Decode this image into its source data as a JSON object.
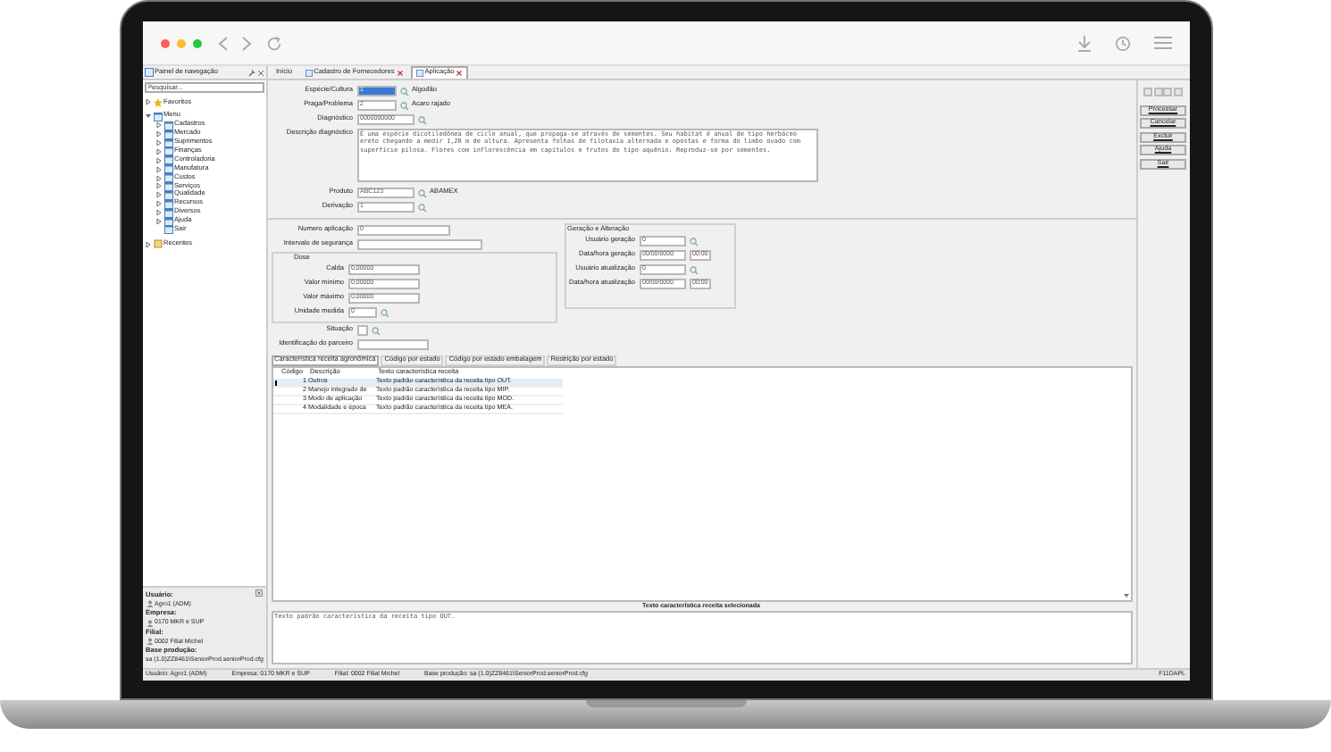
{
  "navigation_panel": {
    "title": "Painel de navegação",
    "search": {
      "placeholder": "Pesquisar..."
    },
    "tree": [
      {
        "label": "Favoritos",
        "kind": "star",
        "expanded": false
      },
      {
        "label": "Menu",
        "kind": "folder",
        "expanded": true,
        "children": [
          {
            "label": "Cadastros",
            "expanded": false
          },
          {
            "label": "Mercado",
            "expanded": false
          },
          {
            "label": "Suprimentos",
            "expanded": false
          },
          {
            "label": "Finanças",
            "expanded": false
          },
          {
            "label": "Controladoria",
            "expanded": false
          },
          {
            "label": "Manufatura",
            "expanded": false
          },
          {
            "label": "Custos",
            "expanded": false
          },
          {
            "label": "Serviços",
            "expanded": false
          },
          {
            "label": "Qualidade",
            "expanded": false
          },
          {
            "label": "Recursos",
            "expanded": false
          },
          {
            "label": "Diversos",
            "expanded": false
          },
          {
            "label": "Ajuda",
            "expanded": false
          },
          {
            "label": "Sair"
          }
        ]
      },
      {
        "label": "Recentes",
        "kind": "clock",
        "expanded": false
      }
    ],
    "session": [
      {
        "label": "Usuário:",
        "value": "Agro1 (ADM)"
      },
      {
        "label": "Empresa:",
        "value": "0170 MKR e SUP"
      },
      {
        "label": "Filial:",
        "value": "0002 Filial Michel"
      },
      {
        "label": "Base produção:",
        "value": "sa (1.0)ZZ8461\\SeniorProd.seniorProd.cfg"
      }
    ]
  },
  "tabs": [
    {
      "label": "Início",
      "closable": false,
      "selected": false
    },
    {
      "label": "Cadastro de Fornecedores",
      "closable": true,
      "selected": false
    },
    {
      "label": "Aplicação",
      "closable": true,
      "selected": true
    }
  ],
  "form": {
    "top": [
      {
        "label": "Espécie/Cultura",
        "value": "1",
        "focused": true,
        "lookup": "Algodão"
      },
      {
        "label": "Praga/Problema",
        "value": "2",
        "focused": false,
        "lookup": "Acaro rajado"
      },
      {
        "label": "Diagnóstico",
        "value": "0000000000",
        "focused": false
      }
    ],
    "description": {
      "label": "Descrição diagnóstico",
      "value": "É uma espécie dicotiledônea de ciclo anual, que propaga-se através de sementes. Seu habitat é anual de tipo herbáceo ereto chegando a medir 1,20 m de altura. Apresenta folhas de filotaxia alternada e opostas e forma do limbo ovado com superfície pilosa. Flores com inflorescência em capítulos e frutos do tipo aquênio. Reproduz-se por sementes."
    },
    "product": [
      {
        "label": "Produto",
        "value": "ABC123",
        "lookup": "ABAMEX"
      },
      {
        "label": "Derivação",
        "value": "1"
      }
    ],
    "application": [
      {
        "label": "Numero aplicação",
        "value": "0"
      },
      {
        "label": "Intervalo de segurança"
      }
    ],
    "dose": {
      "label": "Dose",
      "fields": [
        {
          "label": "Calda",
          "value": "0,00000"
        },
        {
          "label": "Valor mínimo",
          "value": "0,00000"
        },
        {
          "label": "Valor máximo",
          "value": "0,00000"
        },
        {
          "label": "Unidade medida",
          "value": "0"
        }
      ]
    },
    "situation": {
      "label": "Situação"
    },
    "partner": {
      "label": "Identificação do parceiro"
    },
    "audit": {
      "title": "Geração e Alteração",
      "rows": [
        {
          "label": "Usuário geração",
          "value": "0"
        },
        {
          "label": "Data/hora geração",
          "date": "00/00/0000",
          "time": "00:00"
        },
        {
          "label": "Usuário atualização",
          "value": "0"
        },
        {
          "label": "Data/hora atualização",
          "date": "00/00/0000",
          "time": "00:00"
        }
      ]
    }
  },
  "buttons": [
    "Processar",
    "Cancelar",
    "Excluir",
    "Ajuda",
    "Sair"
  ],
  "sub_tabs": [
    {
      "label": "Característica receita agronômica",
      "selected": true
    },
    {
      "label": "Código por estado",
      "selected": false
    },
    {
      "label": "Código por estado embalagem",
      "selected": false
    },
    {
      "label": "Restrição por estado",
      "selected": false
    }
  ],
  "table": {
    "columns": [
      "Código",
      "Descrição",
      "Texto característica receita"
    ],
    "rows": [
      {
        "cells": [
          "1",
          "Outros",
          "Texto padrão característica da receita tipo OUT."
        ],
        "selected": true
      },
      {
        "cells": [
          "2",
          "Manejo integrado de",
          "Texto padrão característica da receita tipo MIP."
        ],
        "selected": false
      },
      {
        "cells": [
          "3",
          "Modo de aplicação",
          "Texto padrão característica da receita tipo MOD."
        ],
        "selected": false
      },
      {
        "cells": [
          "4",
          "Modalidade e época",
          "Texto padrão característica da receita tipo MEA."
        ],
        "selected": false
      }
    ]
  },
  "selected_text": {
    "label": "Texto característica receita selecionada",
    "value": "Texto padrão característica da receita tipo OUT."
  },
  "status_bar": [
    "Usuário: Agro1 (ADM)",
    "Empresa: 0170 MKR e SUP",
    "Filial: 0002 Filial Michel",
    "Base produção: sa (1.0)ZZ8461\\SeniorProd.seniorProd.cfg"
  ],
  "status_right": "F11DAPL"
}
